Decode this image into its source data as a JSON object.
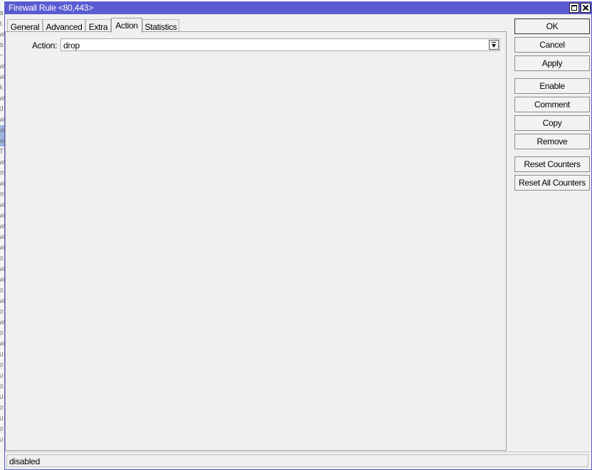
{
  "window": {
    "title": "Firewall Rule <80,443>"
  },
  "tabs": [
    {
      "label": "General",
      "active": false
    },
    {
      "label": "Advanced",
      "active": false
    },
    {
      "label": "Extra",
      "active": false
    },
    {
      "label": "Action",
      "active": true
    },
    {
      "label": "Statistics",
      "active": false
    }
  ],
  "action": {
    "label": "Action:",
    "value": "drop"
  },
  "buttons": {
    "ok": "OK",
    "cancel": "Cancel",
    "apply": "Apply",
    "enable": "Enable",
    "comment": "Comment",
    "copy": "Copy",
    "remove": "Remove",
    "reset_counters": "Reset Counters",
    "reset_all_counters": "Reset All Counters"
  },
  "status": {
    "text": "disabled"
  },
  "background_list": {
    "glyphs": [
      "a",
      "ε",
      "w",
      "a",
      "~",
      "w",
      "w",
      "k",
      "w",
      "d",
      "w",
      "w",
      "w",
      "T",
      "w",
      "m",
      "w",
      "m",
      "w",
      "w",
      "w",
      "w",
      "w",
      "o",
      "w",
      "w",
      "o",
      "w",
      "o",
      "w",
      "o",
      "w",
      "u",
      "o",
      "u",
      "o",
      "u",
      "o",
      "u",
      "o",
      "u"
    ]
  },
  "colors": {
    "titlebar": "#5b5bd1",
    "window_bg": "#f0f0f0",
    "selection": "#9cb6e0"
  }
}
